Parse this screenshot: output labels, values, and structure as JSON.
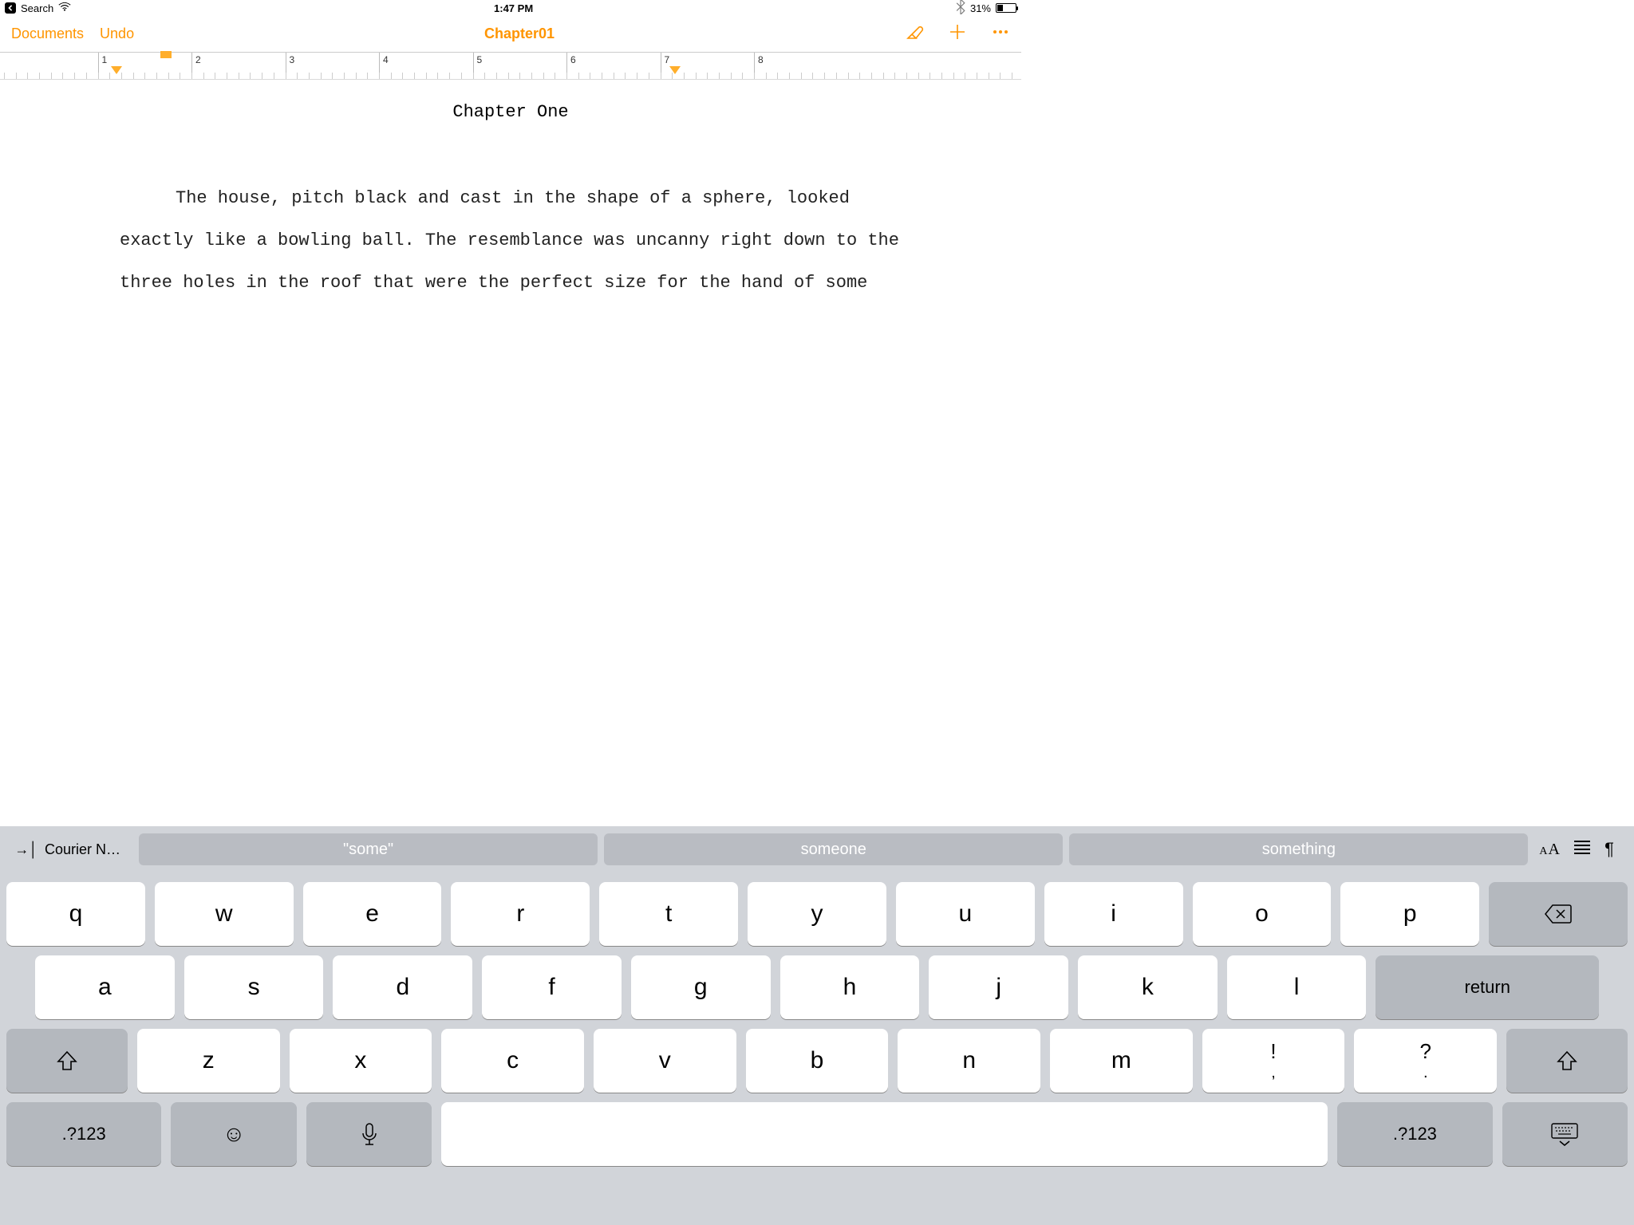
{
  "statusbar": {
    "back_label": "Search",
    "time": "1:47 PM",
    "battery_pct": "31%"
  },
  "toolbar": {
    "documents": "Documents",
    "undo": "Undo",
    "title": "Chapter01"
  },
  "ruler": {
    "labels": [
      "1",
      "2",
      "3",
      "4",
      "5",
      "6",
      "7",
      "8"
    ]
  },
  "document": {
    "heading": "Chapter One",
    "body": "The house, pitch black and cast in the shape of a sphere, looked exactly like a bowling ball.  The resemblance was uncanny right down to the three holes in the roof that were the perfect size for the hand of some"
  },
  "keyboard": {
    "font_name": "Courier N…",
    "suggestions": [
      "\"some\"",
      "someone",
      "something"
    ],
    "row1": [
      "q",
      "w",
      "e",
      "r",
      "t",
      "y",
      "u",
      "i",
      "o",
      "p"
    ],
    "row2": [
      "a",
      "s",
      "d",
      "f",
      "g",
      "h",
      "j",
      "k",
      "l"
    ],
    "return": "return",
    "row3": [
      "z",
      "x",
      "c",
      "v",
      "b",
      "n",
      "m"
    ],
    "punct1_top": "!",
    "punct1_bot": ",",
    "punct2_top": "?",
    "punct2_bot": ".",
    "numswitch": ".?123"
  }
}
